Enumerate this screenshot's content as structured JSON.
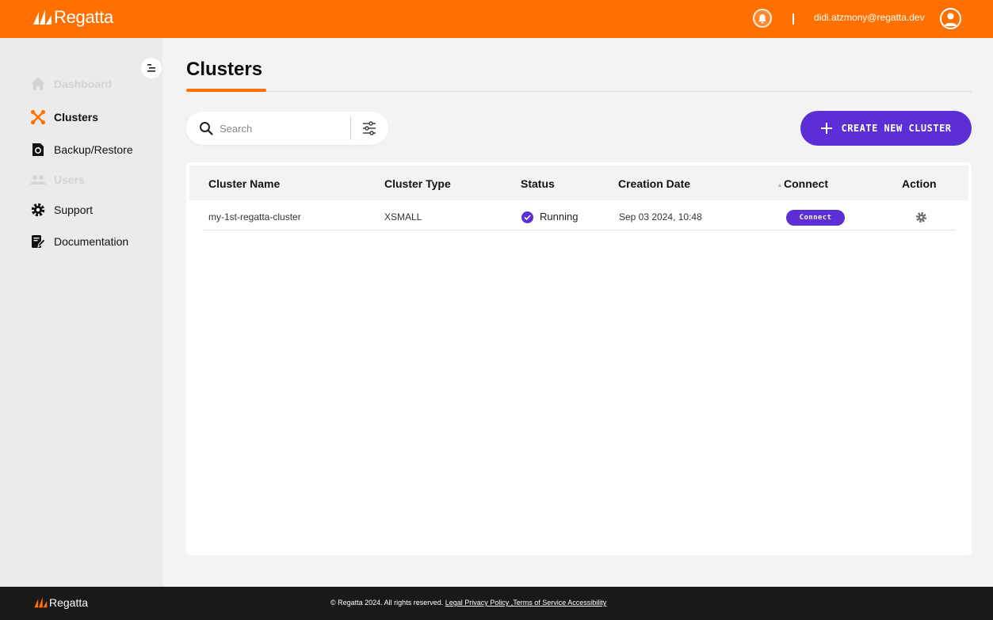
{
  "header": {
    "brand": "Regatta",
    "user_email": "didi.atzmony@regatta.dev",
    "icons": {
      "notifications": "bell-icon",
      "account": "user-avatar-icon"
    }
  },
  "sidebar": {
    "collapse_icon": "collapse-menu-icon",
    "items": [
      {
        "label": "Dashboard",
        "icon": "home-icon",
        "state": "disabled"
      },
      {
        "label": "Clusters",
        "icon": "cluster-nodes-icon",
        "state": "active"
      },
      {
        "label": "Backup/Restore",
        "icon": "backup-icon",
        "state": "normal"
      },
      {
        "label": "Users",
        "icon": "users-icon",
        "state": "disabled"
      },
      {
        "label": "Support",
        "icon": "support-gear-icon",
        "state": "normal"
      },
      {
        "label": "Documentation",
        "icon": "document-edit-icon",
        "state": "normal"
      }
    ]
  },
  "main": {
    "title": "Clusters",
    "search": {
      "placeholder": "Search",
      "value": ""
    },
    "create_button": "CREATE NEW CLUSTER",
    "table": {
      "columns": [
        "Cluster Name",
        "Cluster Type",
        "Status",
        "Creation Date",
        "Connect",
        "Action"
      ],
      "sort_indicator": "▲",
      "rows": [
        {
          "name": "my-1st-regatta-cluster",
          "type": "XSMALL",
          "status": "Running",
          "created": "Sep 03 2024, 10:48",
          "connect": "Connect",
          "action_icon": "settings-gear-icon"
        }
      ]
    }
  },
  "footer": {
    "brand": "Regatta",
    "copyright": "© Regatta 2024. All rights reserved.",
    "links": [
      "Legal Privacy Policy ,Terms of Service Accessibility"
    ]
  },
  "colors": {
    "brand_orange": "#ff7000",
    "accent_purple": "#5b2ed6",
    "footer_bg": "#191919"
  }
}
